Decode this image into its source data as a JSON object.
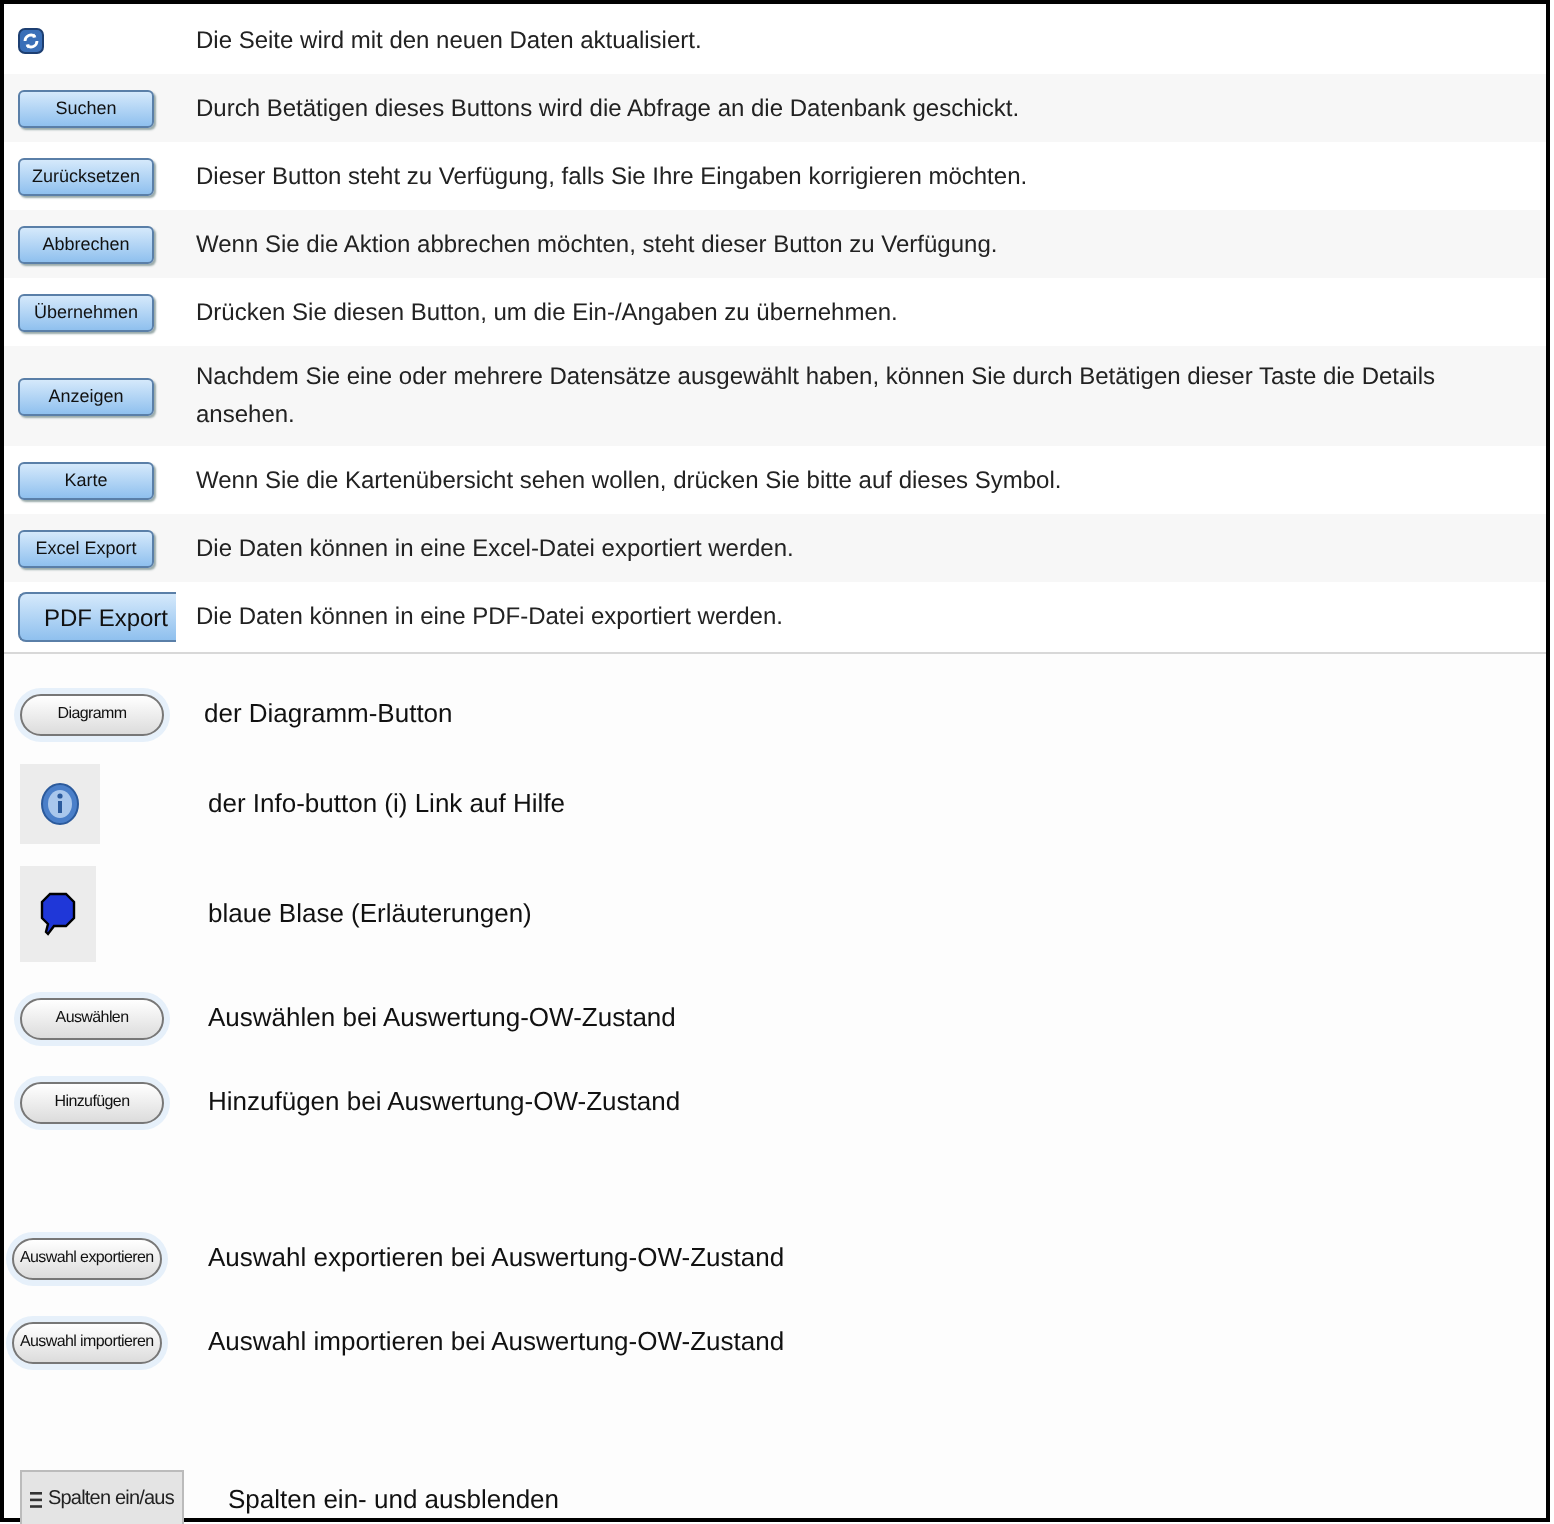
{
  "buttons": [
    {
      "kind": "refresh",
      "description": "Die Seite wird mit den neuen Daten aktualisiert."
    },
    {
      "kind": "button",
      "label": "Suchen",
      "description": "Durch Betätigen dieses Buttons wird die Abfrage an die Datenbank geschickt."
    },
    {
      "kind": "button",
      "label": "Zurücksetzen",
      "description": "Dieser Button steht zu Verfügung, falls Sie Ihre Eingaben korrigieren möchten."
    },
    {
      "kind": "button",
      "label": "Abbrechen",
      "description": "Wenn Sie die Aktion abbrechen möchten, steht dieser Button zu Verfügung."
    },
    {
      "kind": "button",
      "label": "Übernehmen",
      "description": "Drücken Sie diesen Button, um die Ein-/Angaben zu übernehmen."
    },
    {
      "kind": "button",
      "label": "Anzeigen",
      "description": "Nachdem Sie eine oder mehrere Datensätze ausgewählt haben, können Sie durch Betätigen dieser Taste die Details ansehen."
    },
    {
      "kind": "button",
      "label": "Karte",
      "description": "Wenn Sie die Kartenübersicht sehen wollen, drücken Sie bitte auf dieses Symbol."
    },
    {
      "kind": "button",
      "label": "Excel Export",
      "description": "Die Daten können in eine Excel-Datei exportiert werden."
    },
    {
      "kind": "large",
      "label": "PDF Export",
      "description": "Die Daten können in eine PDF-Datei exportiert werden."
    }
  ],
  "more_groups": [
    {
      "items": [
        {
          "kind": "pill",
          "label": "Diagramm",
          "description": "der Diagramm-Button"
        },
        {
          "kind": "info",
          "description": "der Info-button (i) Link auf Hilfe"
        },
        {
          "kind": "bubble",
          "description": "blaue Blase (Erläuterungen)"
        },
        {
          "kind": "pill",
          "label": "Auswählen",
          "description": "Auswählen bei Auswertung-OW-Zustand"
        },
        {
          "kind": "pill",
          "label": "Hinzufügen",
          "description": "Hinzufügen bei Auswertung-OW-Zustand"
        }
      ]
    },
    {
      "items": [
        {
          "kind": "pill",
          "label": "Auswahl exportieren",
          "description": "Auswahl exportieren bei Auswertung-OW-Zustand"
        },
        {
          "kind": "pill",
          "label": "Auswahl importieren",
          "description": "Auswahl importieren bei Auswertung-OW-Zustand"
        }
      ]
    },
    {
      "items": [
        {
          "kind": "columns",
          "label": "Spalten ein/aus",
          "description": "Spalten ein- und ausblenden"
        }
      ]
    }
  ]
}
